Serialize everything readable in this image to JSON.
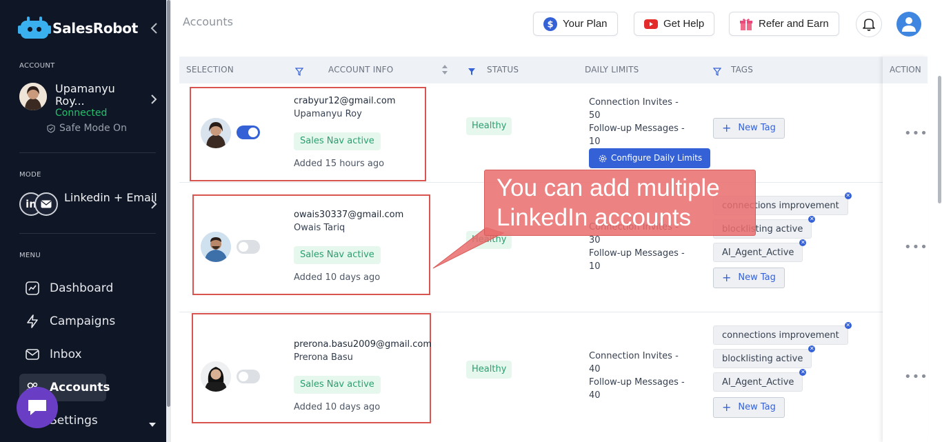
{
  "app": {
    "name": "SalesRobot",
    "page_title": "Accounts"
  },
  "sidebar": {
    "account_label": "ACCOUNT",
    "account_name": "Upamanyu Roy...",
    "account_status": "Connected",
    "safe_mode": "Safe Mode On",
    "mode_label": "MODE",
    "mode_value": "Linkedin + Email",
    "menu_label": "MENU",
    "menu": [
      {
        "label": "Dashboard"
      },
      {
        "label": "Campaigns"
      },
      {
        "label": "Inbox"
      },
      {
        "label": "Accounts"
      },
      {
        "label": "Settings"
      }
    ]
  },
  "header": {
    "plan": "Your Plan",
    "help": "Get Help",
    "refer": "Refer and Earn"
  },
  "table": {
    "columns": {
      "selection": "SELECTION",
      "account_info": "ACCOUNT INFO",
      "status": "STATUS",
      "daily_limits": "DAILY LIMITS",
      "tags": "TAGS",
      "action": "ACTION"
    },
    "configure_label": "Configure Daily Limits",
    "new_tag_label": "New Tag",
    "rows": [
      {
        "email": "crabyur12@gmail.com",
        "name": "Upamanyu Roy",
        "badge": "Sales Nav active",
        "added": "Added 15 hours ago",
        "status": "Healthy",
        "limits": [
          "Connection Invites - 50",
          "Follow-up Messages -",
          "10"
        ],
        "tags": [],
        "enabled": true
      },
      {
        "email": "owais30337@gmail.com",
        "name": "Owais Tariq",
        "badge": "Sales Nav active",
        "added": "Added 10 days ago",
        "status": "Healthy",
        "limits": [
          "Connection Invites - 30",
          "Follow-up Messages -",
          "10"
        ],
        "tags": [
          "connections improvement",
          "blocklisting active",
          "AI_Agent_Active"
        ],
        "enabled": false
      },
      {
        "email": "prerona.basu2009@gmail.com",
        "name": "Prerona Basu",
        "badge": "Sales Nav active",
        "added": "Added 10 days ago",
        "status": "Healthy",
        "limits": [
          "Connection Invites - 40",
          "Follow-up Messages -",
          "40"
        ],
        "tags": [
          "connections improvement",
          "blocklisting active",
          "AI_Agent_Active"
        ],
        "enabled": false
      }
    ]
  },
  "callout": {
    "line1": "You can add multiple",
    "line2": "LinkedIn accounts"
  },
  "colors": {
    "sidebar_bg": "#0f1626",
    "accent": "#3461d6",
    "healthy": "#2aa06e",
    "callout": "#e96c6c",
    "highlight_box": "#d9534f"
  }
}
